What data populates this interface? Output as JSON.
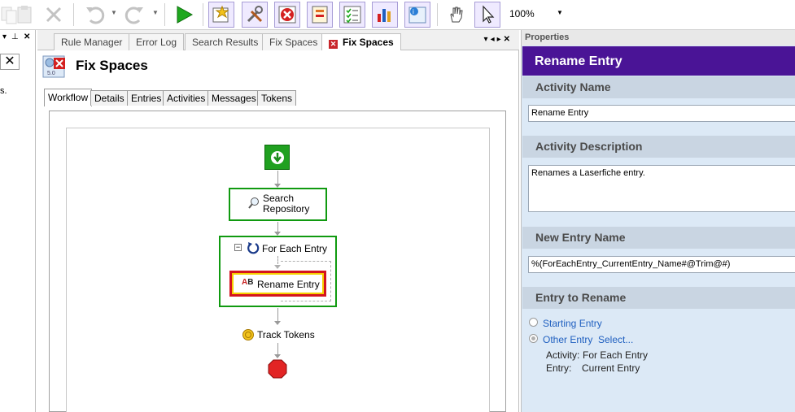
{
  "toolbar": {
    "zoom_label": "100%",
    "icons": [
      "copy-icon",
      "paste-icon",
      "delete-icon",
      "undo-icon",
      "redo-icon",
      "run-icon",
      "find-rule-icon",
      "tools-icon",
      "close-doc-icon",
      "properties-icon",
      "checklist-icon",
      "report-chart-icon",
      "workflow-info-icon",
      "hand-icon",
      "pointer-icon"
    ]
  },
  "left_panel": {
    "partial_text": "s."
  },
  "doc_tabs": [
    {
      "label": "Rule Manager",
      "active": false
    },
    {
      "label": "Error Log",
      "active": false
    },
    {
      "label": "Search Results",
      "active": false
    },
    {
      "label": "Fix Spaces",
      "active": false
    },
    {
      "label": "Fix Spaces",
      "active": true
    }
  ],
  "document": {
    "title": "Fix Spaces",
    "inner_tabs": [
      "Workflow",
      "Details",
      "Entries",
      "Activities",
      "Messages",
      "Tokens"
    ],
    "active_inner_tab": "Workflow",
    "workflow": {
      "search_repository": "Search Repository",
      "for_each_entry": "For Each Entry",
      "rename_entry": "Rename Entry",
      "track_tokens": "Track Tokens"
    }
  },
  "properties": {
    "panel_label": "Properties",
    "title": "Rename Entry",
    "activity_name_label": "Activity Name",
    "activity_name_value": "Rename Entry",
    "activity_description_label": "Activity Description",
    "activity_description_value": "Renames a Laserfiche entry.",
    "new_entry_name_label": "New Entry Name",
    "new_entry_name_value": "%(ForEachEntry_CurrentEntry_Name#@Trim@#)",
    "entry_to_rename_label": "Entry to Rename",
    "option_starting": "Starting Entry",
    "option_other": "Other Entry",
    "select_link": "Select...",
    "activity_key": "Activity:",
    "activity_val": "For Each Entry",
    "entry_key": "Entry:",
    "entry_val": "Current Entry"
  },
  "colors": {
    "accent_purple": "#4a1496",
    "panel_bg": "#dce9f6",
    "section_bg": "#c9d5e2",
    "workflow_green": "#109a10",
    "selected_red": "#d4141e",
    "selected_yellow": "#f5d000"
  }
}
